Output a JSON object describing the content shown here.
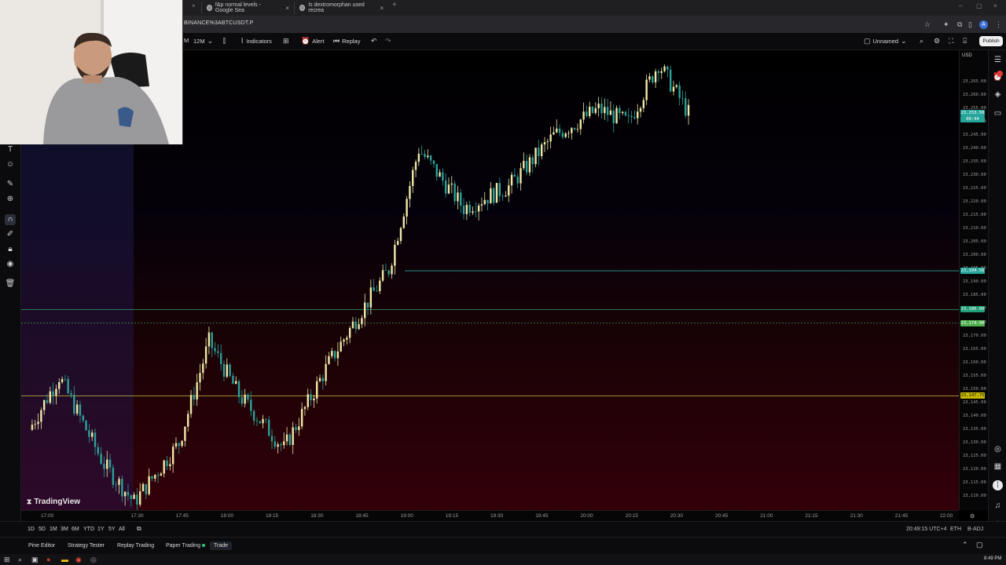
{
  "browser": {
    "tabs": [
      {
        "title": "f&p normal levels - Google Sea",
        "close": "×"
      },
      {
        "title": "Is dextromorphan used recrea",
        "close": "×"
      }
    ],
    "new_tab": "+",
    "first_close": "×",
    "url": "BINANCE%3ABTCUSDT.P",
    "profile_initial": "A",
    "window_controls": [
      "–",
      "▢",
      "×"
    ]
  },
  "toolbar": {
    "interval_prefix": "M",
    "interval": "12M",
    "indicators_label": "Indicators",
    "alert_label": "Alert",
    "replay_label": "Replay",
    "layout_name": "Unnamed",
    "publish_label": "Publish"
  },
  "chart": {
    "currency": "USD",
    "watermark": "TradingView",
    "price_labels": [
      {
        "text": "23,194.50",
        "color": "#26a69a"
      },
      {
        "text": "23,180.00",
        "color": "#1f9e77"
      },
      {
        "text": "23,174.90",
        "color": "#4caf50"
      },
      {
        "text": "23,147.75",
        "color": "#c8b900"
      },
      {
        "text": "23,253.50",
        "color": "#26a69a"
      },
      {
        "text": "00:44",
        "color": "#26a69a"
      }
    ],
    "colors": {
      "up": "#f0e9a8",
      "down": "#2aa198",
      "h1": "#26a69a",
      "h2": "#2e9e6f",
      "h3": "#c8c040"
    }
  },
  "chart_data": {
    "type": "candlestick",
    "symbol": "BINANCE:BTCUSDT.P",
    "interval": "1m",
    "ylim": [
      23105,
      23277
    ],
    "x_tick_labels": [
      "17:00",
      "17:30",
      "17:45",
      "18:00",
      "18:15",
      "18:30",
      "18:45",
      "19:00",
      "19:15",
      "19:30",
      "19:45",
      "20:00",
      "20:15",
      "20:30",
      "20:45",
      "21:00",
      "21:15",
      "21:30",
      "21:45",
      "22:00"
    ],
    "y_tick_labels": [
      "23,265.00",
      "23,260.00",
      "23,255.00",
      "23,250.00",
      "23,245.00",
      "23,240.00",
      "23,235.00",
      "23,230.00",
      "23,225.00",
      "23,220.00",
      "23,215.00",
      "23,210.00",
      "23,205.00",
      "23,200.00",
      "23,195.00",
      "23,190.00",
      "23,185.00",
      "23,180.00",
      "23,175.00",
      "23,170.00",
      "23,165.00",
      "23,160.00",
      "23,155.00",
      "23,150.00",
      "23,145.00",
      "23,140.00",
      "23,135.00",
      "23,130.00",
      "23,125.00",
      "23,120.00",
      "23,115.00",
      "23,110.00"
    ],
    "horizontal_levels": [
      23194.5,
      23180.0,
      23174.9,
      23147.75
    ],
    "key_closes": [
      {
        "time": "16:55",
        "close": 23135
      },
      {
        "time": "17:05",
        "close": 23155
      },
      {
        "time": "17:20",
        "close": 23122
      },
      {
        "time": "17:30",
        "close": 23108
      },
      {
        "time": "17:45",
        "close": 23130
      },
      {
        "time": "17:55",
        "close": 23168
      },
      {
        "time": "18:05",
        "close": 23148
      },
      {
        "time": "18:20",
        "close": 23128
      },
      {
        "time": "18:35",
        "close": 23160
      },
      {
        "time": "18:45",
        "close": 23178
      },
      {
        "time": "18:55",
        "close": 23195
      },
      {
        "time": "19:05",
        "close": 23240
      },
      {
        "time": "19:20",
        "close": 23218
      },
      {
        "time": "19:35",
        "close": 23226
      },
      {
        "time": "19:50",
        "close": 23245
      },
      {
        "time": "20:05",
        "close": 23255
      },
      {
        "time": "20:15",
        "close": 23250
      },
      {
        "time": "20:25",
        "close": 23272
      },
      {
        "time": "20:35",
        "close": 23253.5
      }
    ]
  },
  "timescale": {
    "ranges": [
      "1D",
      "5D",
      "1M",
      "3M",
      "6M",
      "YTD",
      "1Y",
      "5Y",
      "All"
    ],
    "clock": "20:49:15 UTC+4",
    "session": "ETH",
    "adj": "B-ADJ"
  },
  "panel_tabs": [
    "Pine Editor",
    "Strategy Tester",
    "Replay Trading",
    "Paper Trading",
    "Trade"
  ],
  "taskbar": {
    "time": "8:49 PM"
  }
}
